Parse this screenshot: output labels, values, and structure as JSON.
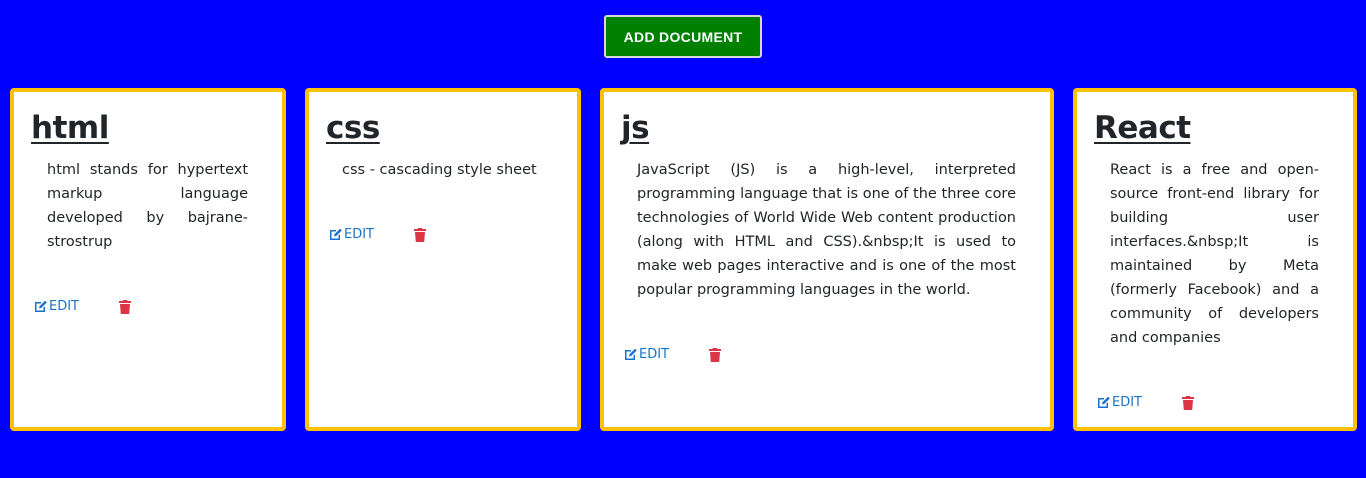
{
  "header": {
    "add_button_label": "ADD DOCUMENT"
  },
  "cards": [
    {
      "title": "html",
      "text": "html stands for hypertext markup language developed by bajrane-strostrup",
      "edit_label": "EDIT"
    },
    {
      "title": "css",
      "text": "css - cascading style sheet",
      "edit_label": "EDIT"
    },
    {
      "title": "js",
      "text": "JavaScript (JS) is a high-level, interpreted programming language that is one of the three core technologies of World Wide Web content production (along with HTML and CSS).&nbsp;It is used to make web pages interactive and is one of the most popular programming languages in the world.",
      "edit_label": "EDIT"
    },
    {
      "title": "React",
      "text": "React is a free and open-source front-end library for building user interfaces.&nbsp;It is maintained by Meta (formerly Facebook) and a community of developers and companies",
      "edit_label": "EDIT"
    }
  ],
  "icons": {
    "edit": "edit-icon",
    "delete": "trash-icon"
  },
  "colors": {
    "background": "#0000ff",
    "add_button": "#008000",
    "card_border": "#ffc107",
    "edit_link": "#1a73c8",
    "delete_icon": "#dc3545"
  }
}
